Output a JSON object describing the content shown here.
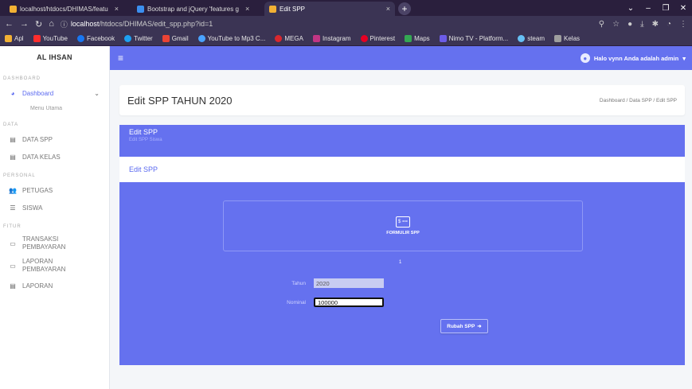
{
  "browser": {
    "tabs": [
      {
        "title": "localhost/htdocs/DHIMAS/featu",
        "color": "#f2b134",
        "active": false
      },
      {
        "title": "Bootstrap and jQuery 'features g",
        "color": "#3b8ff0",
        "active": false
      },
      {
        "title": "Edit SPP",
        "color": "#f2b134",
        "active": true
      }
    ],
    "url_host": "localhost",
    "url_path": "/htdocs/DHIMAS/edit_spp.php?id=1",
    "bookmarks": [
      {
        "label": "Apl",
        "color": "#f2b134"
      },
      {
        "label": "YouTube",
        "color": "#ff2d2d"
      },
      {
        "label": "Facebook",
        "color": "#1877f2"
      },
      {
        "label": "Twitter",
        "color": "#1da1f2"
      },
      {
        "label": "Gmail",
        "color": "#ea4335"
      },
      {
        "label": "YouTube to Mp3 C...",
        "color": "#4aa3ff"
      },
      {
        "label": "MEGA",
        "color": "#d9272e"
      },
      {
        "label": "Instagram",
        "color": "#c13584"
      },
      {
        "label": "Pinterest",
        "color": "#e60023"
      },
      {
        "label": "Maps",
        "color": "#34a853"
      },
      {
        "label": "Nimo TV - Platform...",
        "color": "#6c5ce7"
      },
      {
        "label": "steam",
        "color": "#66c0f4"
      },
      {
        "label": "Kelas",
        "color": "#9e9e9e"
      }
    ]
  },
  "sidebar": {
    "brand": "AL IHSAN",
    "sections": {
      "dashboard": "DASHBOARD",
      "data": "DATA",
      "personal": "PERSONAL",
      "fitur": "FITUR"
    },
    "dashboard_label": "Dashboard",
    "menu_utama": "Menu Utama",
    "data_spp": "DATA SPP",
    "data_kelas": "DATA KELAS",
    "petugas": "PETUGAS",
    "siswa": "SISWA",
    "transaksi_1": "TRANSAKSI",
    "transaksi_2": "PEMBAYARAN",
    "laporan_pembayaran_1": "LAPORAN",
    "laporan_pembayaran_2": "PEMBAYARAN",
    "laporan": "LAPORAN"
  },
  "topnav": {
    "user_text": "Halo vynn Anda adalah admin"
  },
  "header": {
    "title": "Edit SPP TAHUN 2020",
    "breadcrumb": "Dashboard / Data SPP / Edit SPP"
  },
  "band": {
    "title": "Edit SPP",
    "subtitle": "Edit SPP Siswa"
  },
  "strip": {
    "label": "Edit SPP"
  },
  "form": {
    "card_icon": "$",
    "card_label": "FORMULIR SPP",
    "marker": "1",
    "tahun_label": "Tahun",
    "tahun_value": "2020",
    "nominal_label": "Nominal",
    "nominal_value": "100000",
    "submit_label": "Rubah SPP"
  }
}
